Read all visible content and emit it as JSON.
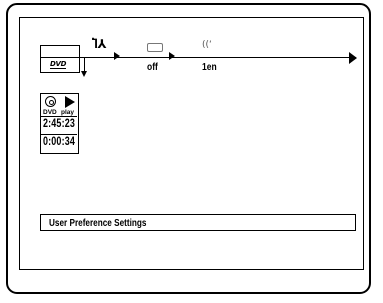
{
  "menu": {
    "icons": [
      "disc-type-icon",
      "setup-tools-icon",
      "subtitle-icon",
      "audio-icon"
    ],
    "disc_logo": "DVD",
    "subtitle_value": "off",
    "audio_value": "1en"
  },
  "status": {
    "disc_label": "DVD",
    "mode_label": "play",
    "total_time": "2:45:23",
    "elapsed_time": "0:00:34"
  },
  "info": {
    "text": "User Preference Settings"
  }
}
